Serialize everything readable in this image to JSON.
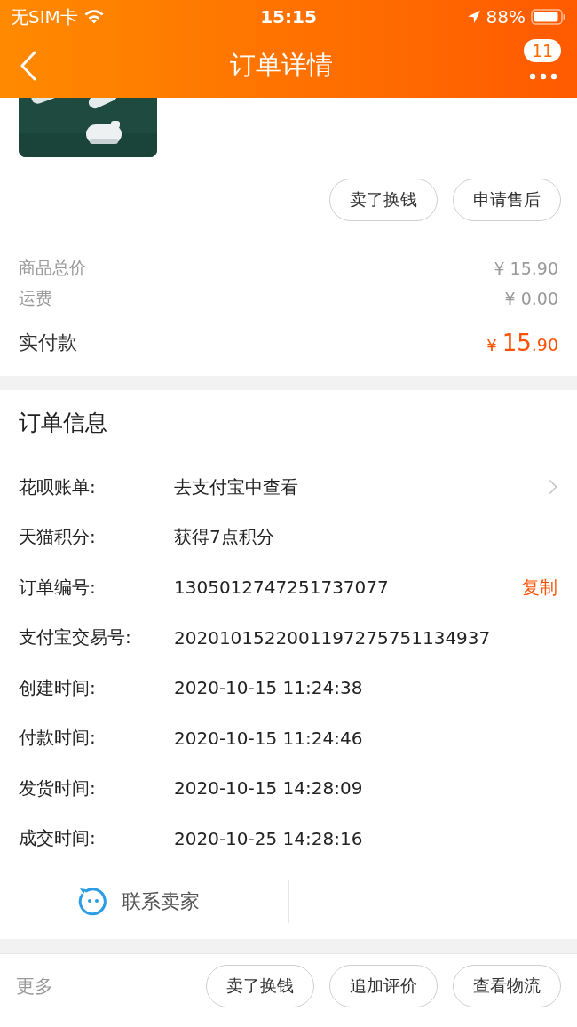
{
  "status_bar": {
    "carrier": "无SIM卡",
    "time": "15:15",
    "battery": "88%"
  },
  "nav": {
    "title": "订单详情",
    "badge": "11"
  },
  "product": {
    "kind": "picture"
  },
  "product_actions": [
    "卖了换钱",
    "申请售后"
  ],
  "price_rows": [
    {
      "label": "商品总价",
      "value": "¥ 15.90"
    },
    {
      "label": "运费",
      "value": "¥ 0.00"
    }
  ],
  "total": {
    "label": "实付款",
    "currency": "¥",
    "integer": "15",
    "decimal": ".90"
  },
  "order_info": {
    "title": "订单信息",
    "rows": [
      {
        "kind": "link",
        "label": "花呗账单:",
        "value": "去支付宝中查看"
      },
      {
        "kind": "plain",
        "label": "天猫积分:",
        "value": "获得7点积分"
      },
      {
        "kind": "copy",
        "label": "订单编号:",
        "value": "1305012747251737077",
        "action": "复制"
      },
      {
        "kind": "plain",
        "label": "支付宝交易号:",
        "value": "2020101522001197275751134937"
      },
      {
        "kind": "plain",
        "label": "创建时间:",
        "value": "2020-10-15 11:24:38"
      },
      {
        "kind": "plain",
        "label": "付款时间:",
        "value": "2020-10-15 11:24:46"
      },
      {
        "kind": "plain",
        "label": "发货时间:",
        "value": "2020-10-15 14:28:09"
      },
      {
        "kind": "plain",
        "label": "成交时间:",
        "value": "2020-10-25 14:28:16"
      }
    ]
  },
  "contact": {
    "label": "联系卖家"
  },
  "footer": {
    "more": "更多",
    "buttons": [
      "卖了换钱",
      "追加评价",
      "查看物流"
    ]
  }
}
